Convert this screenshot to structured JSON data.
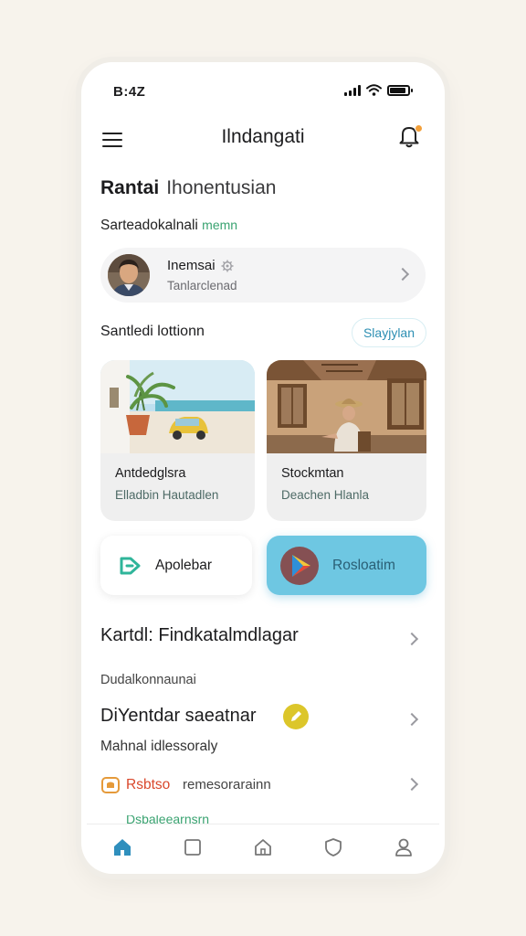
{
  "status_bar": {
    "time": "B:4Z"
  },
  "header": {
    "title": "Ilndangati"
  },
  "section": {
    "bold": "Rantai",
    "light": "Ihonentusian"
  },
  "sub_label": {
    "text": "Sarteadokalnali",
    "accent": "memn"
  },
  "profile": {
    "name": "Inemsai",
    "subtitle": "Tanlarclenad"
  },
  "section2": {
    "title": "Santledi lottionn",
    "button": "Slayjylan"
  },
  "cards": [
    {
      "title": "Antdedglsra",
      "subtitle": "Elladbin Hautadlen"
    },
    {
      "title": "Stockmtan",
      "subtitle": "Deachen Hlanla"
    }
  ],
  "actions": {
    "left_label": "Apolebar",
    "right_label": "Rosloatim"
  },
  "list": {
    "row1_title": "Kartdl: Findkatalmdlagar",
    "caption1": "Dudalkonnaunai",
    "row2_title": "DiYentdar saeatnar",
    "caption2": "Mahnal idlessoraly",
    "row3_title": "Rsbtso",
    "row3_sub": "remesorarainn",
    "row4_partial": "Dsbaleearnsrn"
  },
  "colors": {
    "accent_blue": "#6ec7e2",
    "accent_green": "#3aa371",
    "badge_yellow": "#dcc62a",
    "notif_orange": "#f3a03a",
    "nav_active": "#2f8fbd"
  },
  "icons": [
    "menu-icon",
    "bell-icon",
    "gear-icon",
    "chevron-right-icon",
    "tag-icon",
    "play-icon",
    "pencil-icon",
    "home-icon",
    "square-icon",
    "house-icon",
    "shield-icon",
    "user-icon"
  ]
}
